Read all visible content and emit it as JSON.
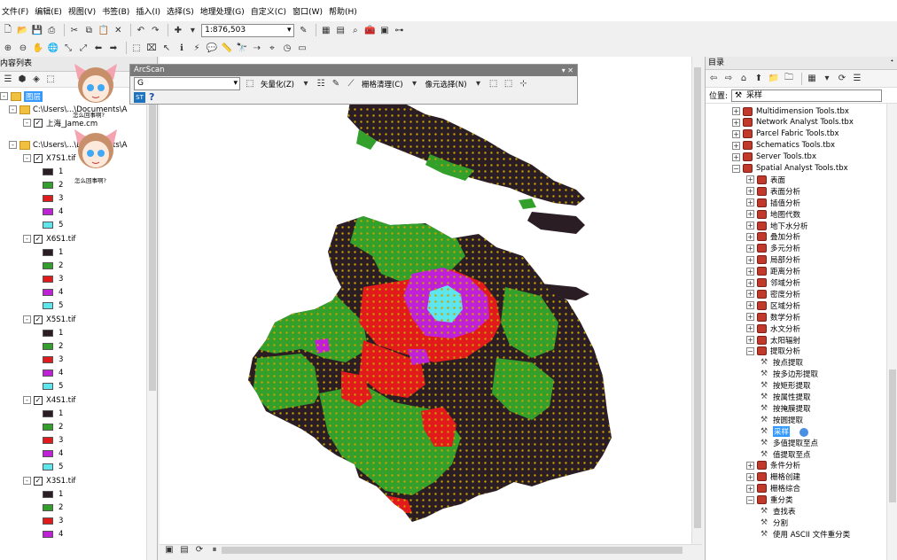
{
  "menu": [
    "文件(F)",
    "编辑(E)",
    "视图(V)",
    "书签(B)",
    "插入(I)",
    "选择(S)",
    "地理处理(G)",
    "自定义(C)",
    "窗口(W)",
    "帮助(H)"
  ],
  "toolbar": {
    "scale": "1:876,503"
  },
  "toc": {
    "title": "内容列表",
    "layers_root": "图层",
    "group1_path": "C:\\Users\\...\\Documents\\A",
    "layer_shanghai": "上海_Jame.cm",
    "group2_path": "C:\\Users\\...\\Documents\\A",
    "rasters": [
      {
        "name": "X7S1.tif",
        "classes": [
          "1",
          "2",
          "3",
          "4",
          "5"
        ]
      },
      {
        "name": "X6S1.tif",
        "classes": [
          "1",
          "2",
          "3",
          "4",
          "5"
        ]
      },
      {
        "name": "X5S1.tif",
        "classes": [
          "1",
          "2",
          "3",
          "4",
          "5"
        ]
      },
      {
        "name": "X4S1.tif",
        "classes": [
          "1",
          "2",
          "3",
          "4",
          "5"
        ]
      },
      {
        "name": "X3S1.tif",
        "classes": [
          "1",
          "2",
          "3",
          "4"
        ]
      }
    ],
    "class_colors": [
      "#2b1d24",
      "#33a02c",
      "#e31a1c",
      "#c020d8",
      "#5ee6ee"
    ],
    "avatar_caption1": "怎么回事啊?",
    "avatar_caption2": "怎么回事啊?"
  },
  "arcscan": {
    "title": "ArcScan",
    "layer_dd": "G",
    "vectorize": "矢量化(Z)",
    "raster_cleanup": "栅格清理(C)",
    "pixel_select": "像元选择(N)",
    "st_label": "ST",
    "help": "?"
  },
  "catalog": {
    "title": "目录",
    "pin": "ᐩ",
    "location_label": "位置:",
    "location_value": "采样",
    "items": [
      {
        "label": "Multidimension Tools.tbx",
        "level": 0,
        "kind": "tbx",
        "exp": "+"
      },
      {
        "label": "Network Analyst Tools.tbx",
        "level": 0,
        "kind": "tbx",
        "exp": "+"
      },
      {
        "label": "Parcel Fabric Tools.tbx",
        "level": 0,
        "kind": "tbx",
        "exp": "+"
      },
      {
        "label": "Schematics Tools.tbx",
        "level": 0,
        "kind": "tbx",
        "exp": "+"
      },
      {
        "label": "Server Tools.tbx",
        "level": 0,
        "kind": "tbx",
        "exp": "+"
      },
      {
        "label": "Spatial Analyst Tools.tbx",
        "level": 0,
        "kind": "tbx",
        "exp": "-"
      },
      {
        "label": "表面",
        "level": 1,
        "kind": "tbx",
        "exp": "+"
      },
      {
        "label": "表面分析",
        "level": 1,
        "kind": "tbx",
        "exp": "+"
      },
      {
        "label": "插值分析",
        "level": 1,
        "kind": "tbx",
        "exp": "+"
      },
      {
        "label": "地图代数",
        "level": 1,
        "kind": "tbx",
        "exp": "+"
      },
      {
        "label": "地下水分析",
        "level": 1,
        "kind": "tbx",
        "exp": "+"
      },
      {
        "label": "叠加分析",
        "level": 1,
        "kind": "tbx",
        "exp": "+"
      },
      {
        "label": "多元分析",
        "level": 1,
        "kind": "tbx",
        "exp": "+"
      },
      {
        "label": "局部分析",
        "level": 1,
        "kind": "tbx",
        "exp": "+"
      },
      {
        "label": "距离分析",
        "level": 1,
        "kind": "tbx",
        "exp": "+"
      },
      {
        "label": "邻域分析",
        "level": 1,
        "kind": "tbx",
        "exp": "+"
      },
      {
        "label": "密度分析",
        "level": 1,
        "kind": "tbx",
        "exp": "+"
      },
      {
        "label": "区域分析",
        "level": 1,
        "kind": "tbx",
        "exp": "+"
      },
      {
        "label": "数学分析",
        "level": 1,
        "kind": "tbx",
        "exp": "+"
      },
      {
        "label": "水文分析",
        "level": 1,
        "kind": "tbx",
        "exp": "+"
      },
      {
        "label": "太阳辐射",
        "level": 1,
        "kind": "tbx",
        "exp": "+"
      },
      {
        "label": "提取分析",
        "level": 1,
        "kind": "tbx",
        "exp": "-"
      },
      {
        "label": "按点提取",
        "level": 2,
        "kind": "tool",
        "exp": ""
      },
      {
        "label": "按多边形提取",
        "level": 2,
        "kind": "tool",
        "exp": ""
      },
      {
        "label": "按矩形提取",
        "level": 2,
        "kind": "tool",
        "exp": ""
      },
      {
        "label": "按属性提取",
        "level": 2,
        "kind": "tool",
        "exp": ""
      },
      {
        "label": "按掩膜提取",
        "level": 2,
        "kind": "tool",
        "exp": ""
      },
      {
        "label": "按圆提取",
        "level": 2,
        "kind": "tool",
        "exp": ""
      },
      {
        "label": "采样",
        "level": 2,
        "kind": "tool",
        "exp": "",
        "selected": true
      },
      {
        "label": "多值提取至点",
        "level": 2,
        "kind": "tool",
        "exp": ""
      },
      {
        "label": "值提取至点",
        "level": 2,
        "kind": "tool",
        "exp": ""
      },
      {
        "label": "条件分析",
        "level": 1,
        "kind": "tbx",
        "exp": "+"
      },
      {
        "label": "栅格创建",
        "level": 1,
        "kind": "tbx",
        "exp": "+"
      },
      {
        "label": "栅格综合",
        "level": 1,
        "kind": "tbx",
        "exp": "+"
      },
      {
        "label": "重分类",
        "level": 1,
        "kind": "tbx",
        "exp": "-"
      },
      {
        "label": "查找表",
        "level": 2,
        "kind": "tool",
        "exp": ""
      },
      {
        "label": "分割",
        "level": 2,
        "kind": "tool",
        "exp": ""
      },
      {
        "label": "使用 ASCII 文件重分类",
        "level": 2,
        "kind": "tool",
        "exp": ""
      }
    ]
  },
  "map": {
    "colors": {
      "black": "#2b1d24",
      "green": "#33a02c",
      "red": "#e31a1c",
      "purple": "#c020d8",
      "cyan": "#5ee6ee",
      "dot": "#c8a000"
    }
  }
}
